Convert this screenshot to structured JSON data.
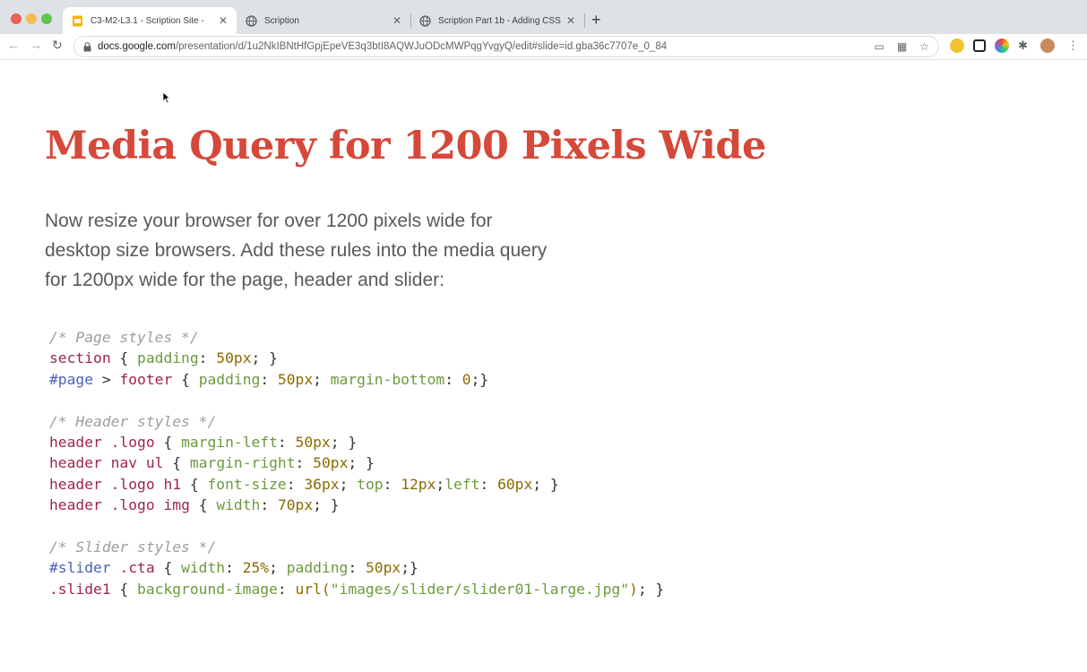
{
  "browser": {
    "tabs": [
      {
        "label": "C3-M2-L3.1 - Scription Site - ",
        "active": true,
        "favicon": "google-slides-icon"
      },
      {
        "label": "Scription",
        "active": false,
        "favicon": "globe-icon"
      },
      {
        "label": "Scription Part 1b - Adding CSS",
        "active": false,
        "favicon": "globe-icon"
      }
    ],
    "url": {
      "host": "docs.google.com",
      "path": "/presentation/d/1u2NkIBNtHfGpjEpeVE3q3btI8AQWJuODcMWPqgYvgyQ/edit#slide=id.gba36c7707e_0_84"
    },
    "new_tab_label": "+"
  },
  "slide": {
    "title": "Media Query for 1200 Pixels Wide",
    "paragraph_lines": [
      "Now resize your browser for over 1200 pixels wide for",
      "desktop size browsers. Add these rules into the media query",
      "for 1200px wide for the page, header and slider:"
    ],
    "code_lines": [
      "/* Page styles */",
      "section { padding: 50px; }",
      "#page > footer { padding: 50px; margin-bottom: 0;}",
      "",
      "/* Header styles */",
      "header .logo { margin-left: 50px; }",
      "header nav ul { margin-right: 50px; }",
      "header .logo h1 { font-size: 36px; top: 12px;left: 60px; }",
      "header .logo img { width: 70px; }",
      "",
      "/* Slider styles */",
      "#slider .cta { width: 25%; padding: 50px;}",
      ".slide1 { background-image: url(\"images/slider/slider01-large.jpg\"); }"
    ]
  },
  "colors": {
    "title": "#d5483a",
    "body_text": "#595959",
    "code_comment": "#9e9e9e",
    "code_selector": "#a02548",
    "code_id_selector": "#4a5fbf",
    "code_property": "#6c9a3c",
    "code_value": "#8d6a00"
  }
}
